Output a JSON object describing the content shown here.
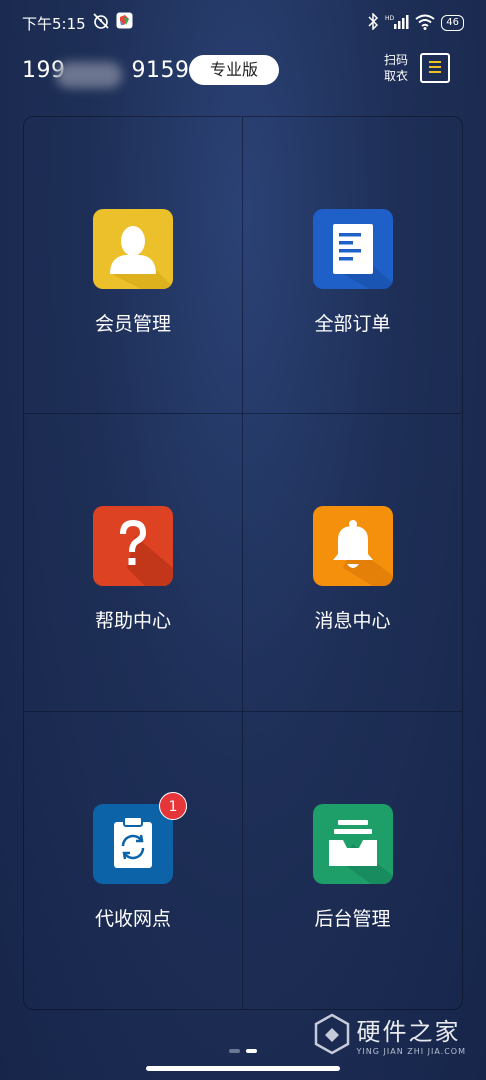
{
  "status_bar": {
    "time": "下午5:15",
    "battery": "46",
    "network": "HD"
  },
  "header": {
    "phone_prefix": "199",
    "phone_suffix": "9159",
    "edition_label": "专业版",
    "scan_label_line1": "扫码",
    "scan_label_line2": "取衣"
  },
  "grid": {
    "items": [
      {
        "label": "会员管理",
        "icon": "member-icon",
        "color": "#ecc02a"
      },
      {
        "label": "全部订单",
        "icon": "order-list-icon",
        "color": "#1f60c8"
      },
      {
        "label": "帮助中心",
        "icon": "question-icon",
        "color": "#dd4223"
      },
      {
        "label": "消息中心",
        "icon": "bell-icon",
        "color": "#f5900c"
      },
      {
        "label": "代收网点",
        "icon": "clipboard-refresh-icon",
        "color": "#0d63a8",
        "badge": "1"
      },
      {
        "label": "后台管理",
        "icon": "inbox-tray-icon",
        "color": "#1e9e68"
      }
    ]
  },
  "pager": {
    "pages": 2,
    "active": 2
  },
  "watermark": {
    "title": "硬件之家",
    "subtitle": "YING JIAN ZHI JIA.COM"
  }
}
